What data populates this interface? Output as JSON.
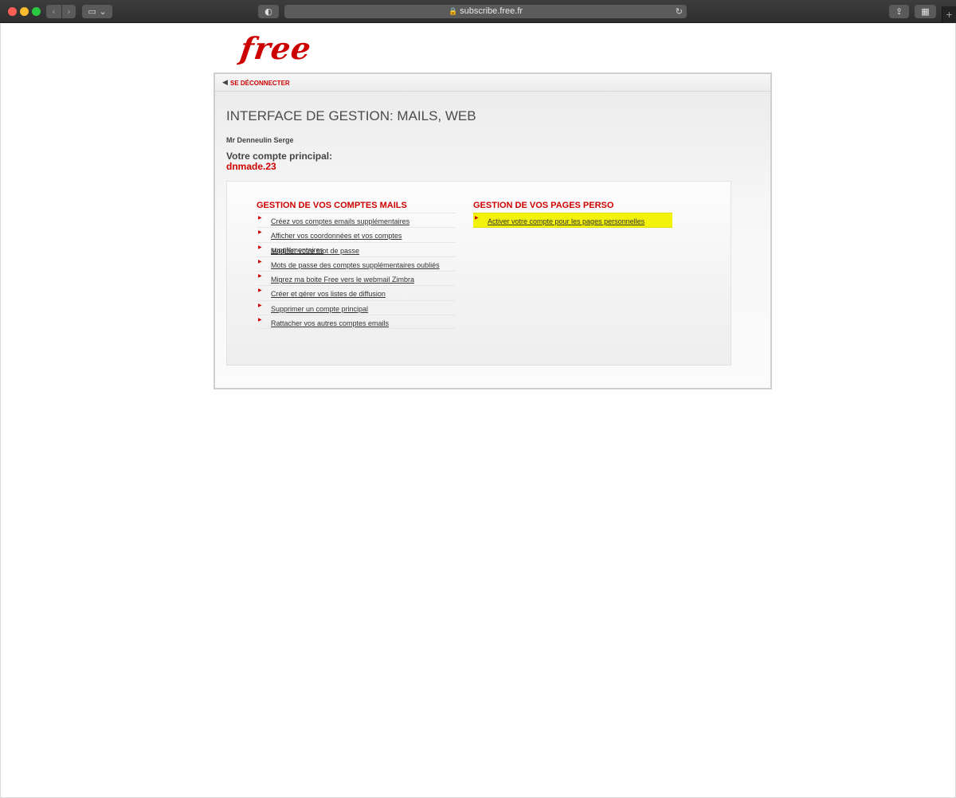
{
  "browser": {
    "url": "subscribe.free.fr",
    "icons": {
      "back": "chevron-left-icon",
      "forward": "chevron-right-icon",
      "sidebar": "sidebar-icon",
      "shield": "shield-icon",
      "lock": "lock-icon",
      "reload": "reload-icon",
      "share": "share-icon",
      "tabs": "tabs-overview-icon",
      "new_tab": "plus-icon"
    }
  },
  "logo": {
    "text": "free"
  },
  "topbar": {
    "logout_label": "SE DÉCONNECTER"
  },
  "main": {
    "title": "INTERFACE DE GESTION: MAILS, WEB",
    "user_name": "Mr Denneulin Serge",
    "account_label": "Votre compte principal:",
    "account_id": "dnmade.23"
  },
  "mail_section": {
    "title": "GESTION DE VOS COMPTES MAILS",
    "links": [
      "Créez vos comptes emails supplémentaires",
      "Afficher vos coordonnées et vos comptes supplémentaires",
      "Modifier votre mot de passe",
      "Mots de passe des comptes supplémentaires oubliés",
      "Migrez ma boite Free vers le webmail Zimbra",
      "Créer et gérer vos listes de diffusion",
      "Supprimer un compte principal",
      "Rattacher vos autres comptes emails"
    ]
  },
  "perso_section": {
    "title": "GESTION DE VOS PAGES PERSO",
    "links": [
      "Activer votre compte pour les pages personnelles"
    ],
    "highlight_color": "#f2f20c"
  },
  "colors": {
    "brand_red": "#cc0000",
    "text_gray": "#4c4c4c"
  }
}
